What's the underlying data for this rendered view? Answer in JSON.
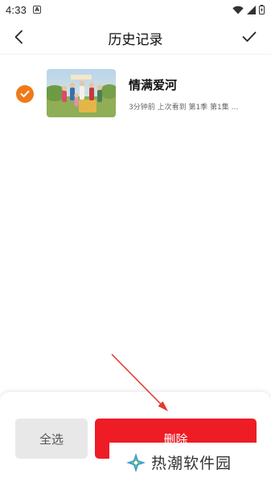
{
  "status_bar": {
    "time": "4:33",
    "notification_icon_letter": "A"
  },
  "nav": {
    "title": "历史记录",
    "back_icon": "chevron-left-icon",
    "confirm_icon": "checkmark-icon"
  },
  "history": {
    "items": [
      {
        "title": "情满爱河",
        "meta": "3分钟前 上次看到 第1季 第1集 ...",
        "selected": true
      }
    ]
  },
  "actions": {
    "select_all": "全选",
    "delete": "删除"
  },
  "watermark": {
    "text": "热潮软件园"
  },
  "colors": {
    "accent_orange": "#f07a1a",
    "delete_red": "#ee1c25",
    "select_all_bg": "#e8e8e8",
    "annotation_red": "#e23a2a"
  }
}
